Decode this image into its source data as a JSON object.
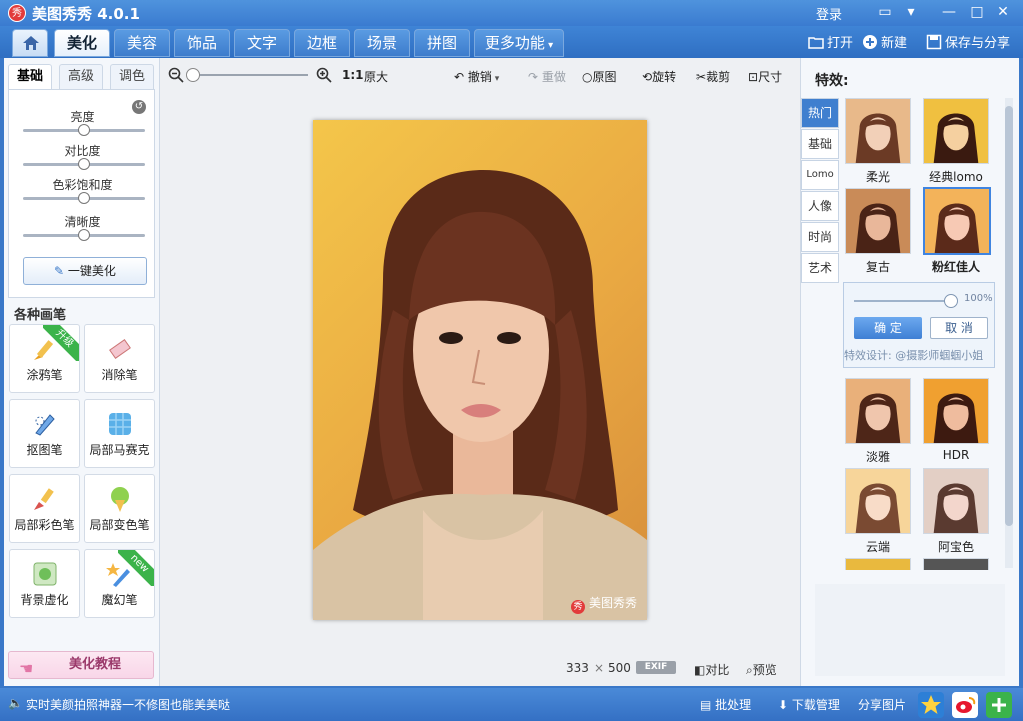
{
  "window": {
    "logo_text": "秀",
    "title": "美图秀秀 4.0.1",
    "login": "登录"
  },
  "tabs": [
    {
      "label": "美化",
      "active": true
    },
    {
      "label": "美容",
      "active": false
    },
    {
      "label": "饰品",
      "active": false
    },
    {
      "label": "文字",
      "active": false
    },
    {
      "label": "边框",
      "active": false
    },
    {
      "label": "场景",
      "active": false
    },
    {
      "label": "拼图",
      "active": false
    },
    {
      "label": "更多功能",
      "active": false
    }
  ],
  "header_actions": {
    "open": "打开",
    "new": "新建",
    "save_share": "保存与分享"
  },
  "left_panel": {
    "subtabs": [
      "基础",
      "高级",
      "调色"
    ],
    "sliders": [
      {
        "label": "亮度",
        "value": 0.5
      },
      {
        "label": "对比度",
        "value": 0.5
      },
      {
        "label": "色彩饱和度",
        "value": 0.5
      },
      {
        "label": "清晰度",
        "value": 0.5
      }
    ],
    "one_key": "一键美化",
    "brush_section_title": "各种画笔",
    "brushes": [
      {
        "label": "涂鸦笔",
        "badge": "升级"
      },
      {
        "label": "消除笔",
        "badge": ""
      },
      {
        "label": "抠图笔",
        "badge": ""
      },
      {
        "label": "局部马赛克",
        "badge": ""
      },
      {
        "label": "局部彩色笔",
        "badge": ""
      },
      {
        "label": "局部变色笔",
        "badge": ""
      },
      {
        "label": "背景虚化",
        "badge": ""
      },
      {
        "label": "魔幻笔",
        "badge": "new"
      }
    ],
    "tutorial": "美化教程"
  },
  "toolbar": {
    "ratio": "1:1",
    "original_size": "原大",
    "undo": "撤销",
    "redo": "重做",
    "original_image": "原图",
    "rotate": "旋转",
    "crop": "裁剪",
    "size": "尺寸",
    "zoom": 0.0
  },
  "image": {
    "watermark": "美图秀秀",
    "width": "333",
    "times": "×",
    "height": "500",
    "exif": "EXIF",
    "compare": "对比",
    "preview": "预览"
  },
  "right_panel": {
    "title": "特效:",
    "categories": [
      "热门",
      "基础",
      "Lomo",
      "人像",
      "时尚",
      "艺术"
    ],
    "effects": [
      {
        "label": "柔光"
      },
      {
        "label": "经典lomo"
      },
      {
        "label": "复古"
      },
      {
        "label": "粉红佳人",
        "selected": true
      },
      {
        "label": "淡雅"
      },
      {
        "label": "HDR"
      },
      {
        "label": "云端"
      },
      {
        "label": "阿宝色"
      }
    ],
    "popup": {
      "percent": "100%",
      "ok": "确 定",
      "cancel": "取 消",
      "design_credit": "特效设计: @摄影师蝈蝈小姐"
    }
  },
  "status_bar": {
    "message": "实时美颜拍照神器一不修图也能美美哒",
    "batch": "批处理",
    "download": "下载管理",
    "share": "分享图片"
  },
  "colors": {
    "accent": "#3a78c8",
    "active_category": "#3f7fcf",
    "badge_green": "#3bb34a"
  }
}
